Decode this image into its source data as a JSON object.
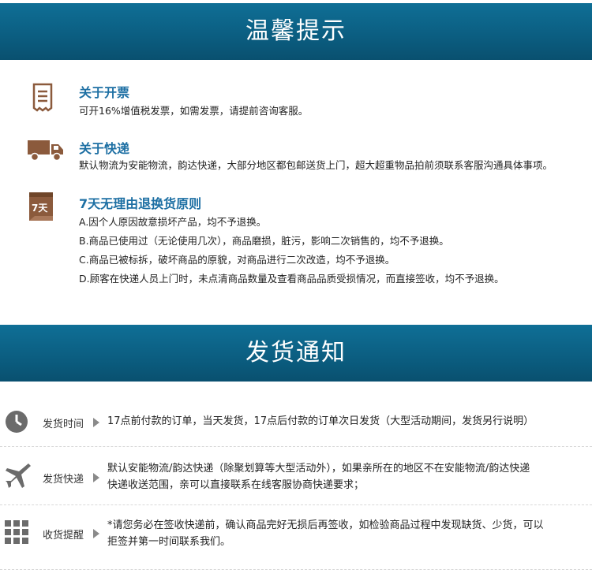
{
  "banner_tips": "温馨提示",
  "banner_shipping": "发货通知",
  "tips": [
    {
      "icon": "receipt-icon",
      "title": "关于开票",
      "lines": [
        "可开16%增值税发票，如需发票，请提前咨询客服。"
      ]
    },
    {
      "icon": "truck-icon",
      "title": "关于快递",
      "lines": [
        "默认物流为安能物流，韵达快递，大部分地区都包邮送货上门，超大超重物品拍前须联系客服沟通具体事项。"
      ]
    },
    {
      "icon": "calendar-7-icon",
      "title": "7天无理由退换货原则",
      "icon_text": "7天",
      "lines": [
        "A.因个人原因故意损坏产品，均不予退换。",
        "B.商品已使用过（无论使用几次），商品磨损，脏污，影响二次销售的，均不予退换。",
        "C.商品已被标拆，破坏商品的原貌，对商品进行二次改造，均不予退换。",
        "D.顾客在快递人员上门时，未点清商品数量及查看商品品质受损情况，而直接签收，均不予退换。"
      ]
    }
  ],
  "shipping": [
    {
      "icon": "clock-icon",
      "label": "发货时间",
      "lines": [
        "17点前付款的订单，当天发货，17点后付款的订单次日发货（大型活动期间，发货另行说明）"
      ]
    },
    {
      "icon": "airplane-icon",
      "label": "发货快递",
      "lines": [
        "默认安能物流/韵达快递（除聚划算等大型活动外），如果亲所在的地区不在安能物流/韵达快递",
        "快递收送范围，亲可以直接联系在线客服协商快递要求；"
      ]
    },
    {
      "icon": "grid-icon",
      "label": "收货提醒",
      "lines": [
        "*请您务必在签收快递前，确认商品完好无损后再签收，如检验商品过程中发现缺货、少货，可以",
        "拒签并第一时间联系我们。"
      ]
    }
  ],
  "colors": {
    "banner": "#0b5d80",
    "title": "#1d6fa3",
    "icon_brown": "#8b5a3c"
  }
}
